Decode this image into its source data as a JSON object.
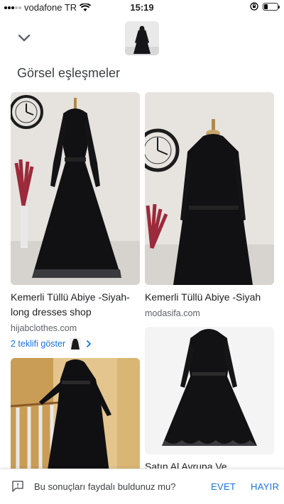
{
  "status_bar": {
    "carrier": "vodafone TR",
    "time": "15:19"
  },
  "header": {
    "title": "Görsel eşleşmeler"
  },
  "results": [
    {
      "title": "Kemerli Tüllü Abiye -Siyah-long dresses shop",
      "source": "hijabclothes.com",
      "offers": "2 teklifi göster"
    },
    {
      "title": "Kemerli Tüllü Abiye -Siyah",
      "source": "modasifa.com"
    },
    {
      "title": ""
    },
    {
      "title": "Satın Al Avrupa Ve"
    }
  ],
  "feedback": {
    "question": "Bu sonuçları faydalı buldunuz mu?",
    "yes": "EVET",
    "no": "HAYIR"
  },
  "colors": {
    "accent": "#1a73e8",
    "text": "#202124",
    "secondary_text": "#5f6368"
  }
}
